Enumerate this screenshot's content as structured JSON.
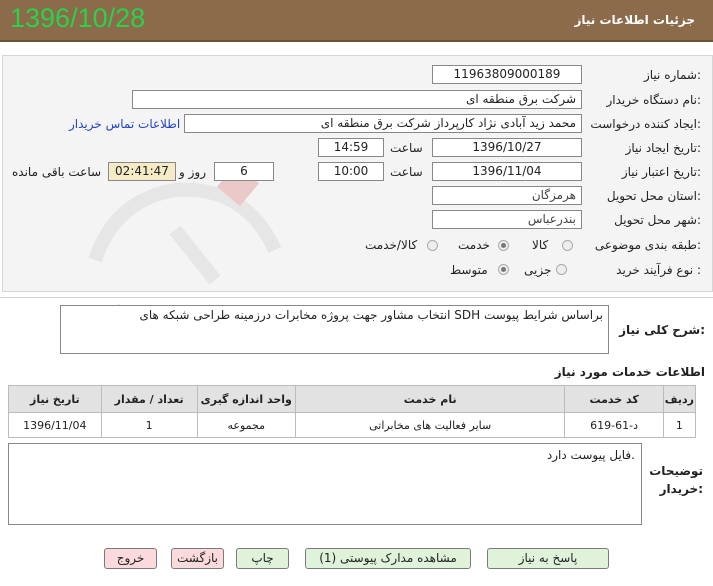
{
  "header": {
    "title": "جزئیات اطلاعات نیاز",
    "date": "1396/10/28"
  },
  "form": {
    "need_number_label": "شماره نیاز:",
    "need_number": "1196380900018‌9",
    "buyer_label": "نام دستگاه خریدار:",
    "buyer": "شرکت برق منطقه ای",
    "requester_label": "ایجاد کننده درخواست:",
    "requester": "محمد زید آبادی نژاد کارپرداز شرکت برق منطقه ای",
    "contact_link": "اطلاعات تماس خریدار",
    "created_label": "تاریخ ایجاد نیاز:",
    "created_date": "1396/10/27",
    "hour_label": "ساعت",
    "created_time": "14:59",
    "validity_label": "تاریخ اعتبار نیاز:",
    "validity_date": "1396/11/04",
    "validity_time": "10:00",
    "days_value": "6",
    "days_label": "روز و",
    "remaining_time": "02:41:47",
    "remaining_label": "ساعت باقی مانده",
    "province_label": "استان محل تحویل:",
    "province": "هرمزگان",
    "city_label": "شهر محل تحویل:",
    "city": "بندرعباس",
    "category_label": "طبقه بندی موضوعی:",
    "category_options": [
      "کالا",
      "خدمت",
      "کالا/خدمت"
    ],
    "category_selected": "خدمت",
    "process_label": "نوع فرآیند خرید :",
    "process_options": [
      "جزیی",
      "متوسط"
    ],
    "process_selected": "متوسط"
  },
  "description": {
    "label": "شرح کلی نیاز:",
    "text": "انتخاب مشاور جهت پروژه مخابرات درزمینه طراحی شبکه های SDH براساس شرایط پیوست"
  },
  "services": {
    "title": "اطلاعات خدمات مورد نیاز",
    "columns": [
      "ردیف",
      "کد خدمت",
      "نام خدمت",
      "واحد اندازه گیری",
      "تعداد / مقدار",
      "تاریخ نیاز"
    ],
    "rows": [
      [
        "1",
        "د-61-619",
        "سایر فعالیت های مخابراتی",
        "مجموعه",
        "1",
        "1396/11/04"
      ]
    ]
  },
  "buyer_notes": {
    "label": "توضیحات خریدار:",
    "text": "فایل پیوست دارد."
  },
  "buttons": {
    "reply": "پاسخ به نیاز",
    "attachments": "مشاهده مدارک پیوستی (1)",
    "print": "چاپ",
    "back": "بازگشت",
    "exit": "خروج"
  },
  "colors": {
    "header_bg": "#8c6b4a",
    "date_green": "#2bd14a",
    "link_blue": "#2244cc",
    "time_box": "#f5ecc6"
  }
}
